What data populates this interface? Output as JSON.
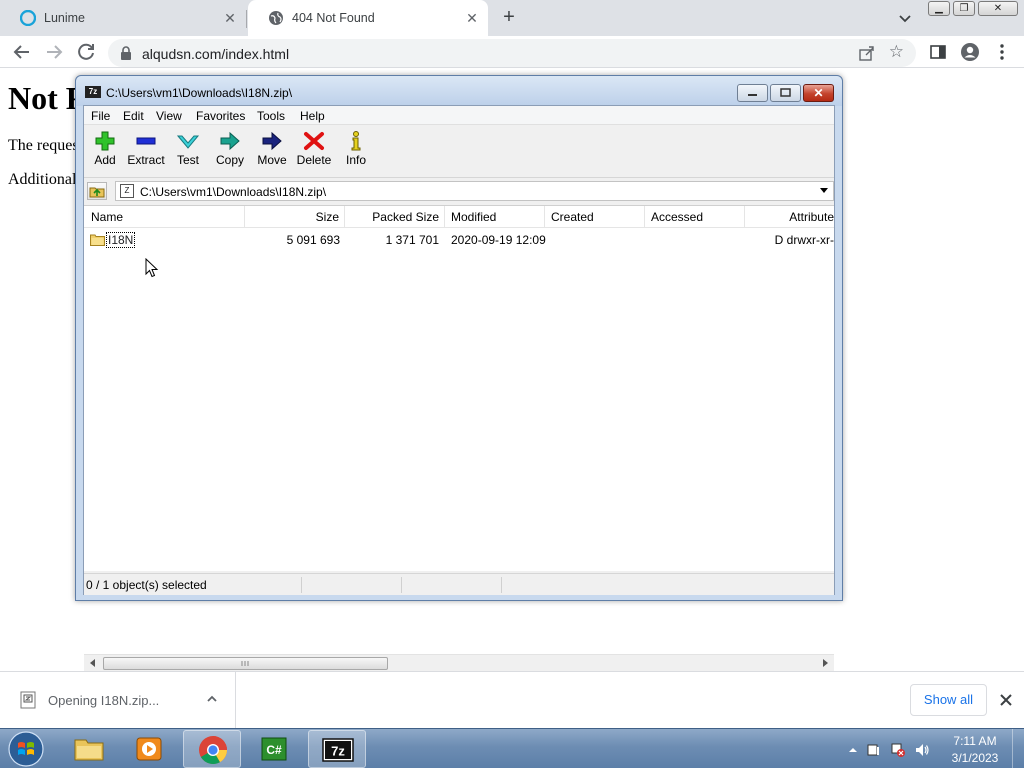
{
  "browser": {
    "tabs": [
      {
        "title": "Lunime",
        "icon": "lunime-icon"
      },
      {
        "title": "404 Not Found",
        "icon": "globe-icon"
      }
    ],
    "url": "alqudsn.com/index.html"
  },
  "page": {
    "heading": "Not F",
    "para1": "The reques",
    "para2": "Additional"
  },
  "zip": {
    "title": "C:\\Users\\vm1\\Downloads\\I18N.zip\\",
    "app_icon_text": "7z",
    "menu": [
      "File",
      "Edit",
      "View",
      "Favorites",
      "Tools",
      "Help"
    ],
    "tools": [
      {
        "label": "Add",
        "icon": "add-icon"
      },
      {
        "label": "Extract",
        "icon": "extract-icon"
      },
      {
        "label": "Test",
        "icon": "test-icon"
      },
      {
        "label": "Copy",
        "icon": "copy-icon"
      },
      {
        "label": "Move",
        "icon": "move-icon"
      },
      {
        "label": "Delete",
        "icon": "delete-icon"
      },
      {
        "label": "Info",
        "icon": "info-icon"
      }
    ],
    "address": "C:\\Users\\vm1\\Downloads\\I18N.zip\\",
    "columns": [
      "Name",
      "Size",
      "Packed Size",
      "Modified",
      "Created",
      "Accessed",
      "Attribute"
    ],
    "rows": [
      {
        "name": "I18N",
        "size": "5 091 693",
        "packed": "1 371 701",
        "modified": "2020-09-19 12:09",
        "created": "",
        "accessed": "",
        "attr": "D drwxr-xr-"
      }
    ],
    "status": "0 / 1 object(s) selected"
  },
  "downloads": {
    "item": "Opening I18N.zip...",
    "show_all": "Show all"
  },
  "taskbar": {
    "time": "7:11 AM",
    "date": "3/1/2023",
    "items": [
      "explorer-icon",
      "media-player-icon",
      "chrome-icon",
      "csharp-icon",
      "sevenzip-icon"
    ]
  },
  "colors": {
    "accent_blue": "#1a73e8",
    "tabstrip": "#dee1e6",
    "zip_close_red": "#c4432c"
  }
}
